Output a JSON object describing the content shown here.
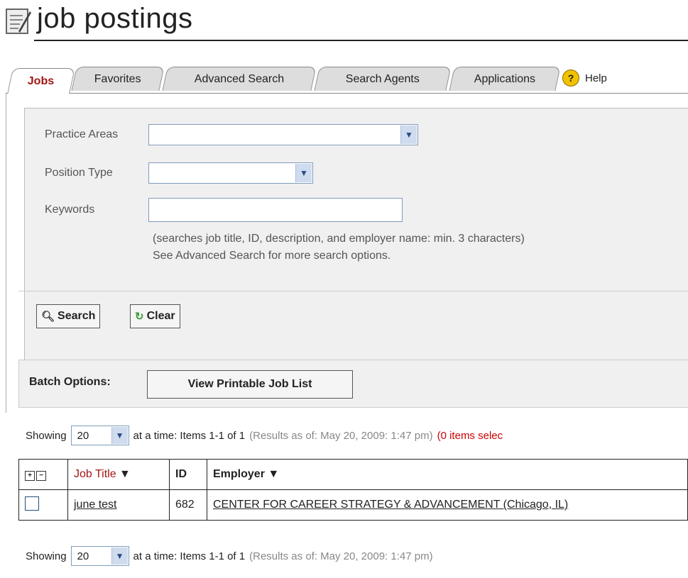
{
  "header": {
    "title": "job postings"
  },
  "tabs": [
    {
      "label": "Jobs",
      "active": true
    },
    {
      "label": "Favorites",
      "active": false
    },
    {
      "label": "Advanced Search",
      "active": false
    },
    {
      "label": "Search Agents",
      "active": false
    },
    {
      "label": "Applications",
      "active": false
    }
  ],
  "help": {
    "label": "Help",
    "icon": "question-icon"
  },
  "search": {
    "practice_areas_label": "Practice Areas",
    "practice_areas_value": "",
    "position_type_label": "Position Type",
    "position_type_value": "",
    "keywords_label": "Keywords",
    "keywords_value": "",
    "hint_line1": "(searches job title, ID, description, and employer name: min. 3 characters)",
    "hint_line2": "See Advanced Search for more search options.",
    "search_button": "Search",
    "clear_button": "Clear"
  },
  "batch": {
    "label": "Batch Options:",
    "printable_button": "View Printable Job List"
  },
  "pager_top": {
    "showing": "Showing",
    "per_page": "20",
    "at_a_time": "at a time: Items 1-1 of 1",
    "results_as_of": "(Results as of: May 20, 2009: 1:47 pm)",
    "selected": "(0 items selec"
  },
  "table": {
    "headers": [
      "Job Title",
      "ID",
      "Employer"
    ],
    "rows": [
      {
        "title": "june test",
        "id": "682",
        "employer": "CENTER FOR CAREER STRATEGY & ADVANCEMENT (Chicago, IL)"
      }
    ]
  },
  "pager_bottom": {
    "showing": "Showing",
    "per_page": "20",
    "at_a_time": "at a time: Items 1-1 of 1",
    "results_as_of": "(Results as of: May 20, 2009: 1:47 pm)"
  },
  "colors": {
    "accent": "#a31515",
    "panel_bg": "#f0f0f0",
    "select_arrow_bg": "#cfdbee"
  }
}
